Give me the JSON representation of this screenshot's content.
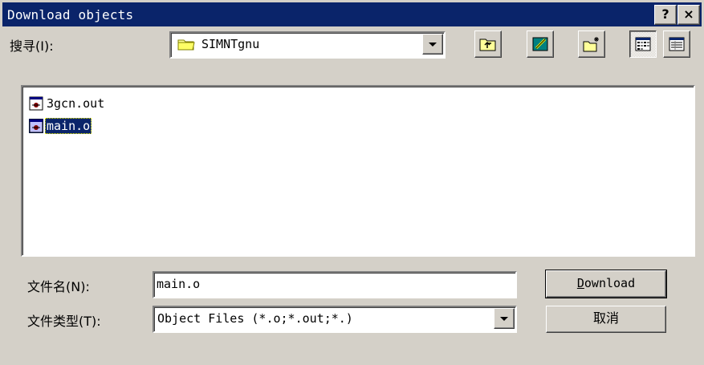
{
  "window": {
    "title": "Download objects",
    "help_label": "?",
    "close_label": "×"
  },
  "lookin": {
    "label": "搜寻(I):",
    "value": "SIMNTgnu"
  },
  "toolbar": {
    "icons": [
      "up-folder-icon",
      "desktop-icon",
      "new-folder-icon",
      "list-view-icon",
      "details-view-icon"
    ]
  },
  "files": [
    {
      "name": "3gcn.out",
      "icon": "executable-file-icon",
      "selected": false
    },
    {
      "name": "main.o",
      "icon": "executable-file-icon",
      "selected": true
    }
  ],
  "filename": {
    "label": "文件名(N):",
    "value": "main.o"
  },
  "filetype": {
    "label": "文件类型(T):",
    "value": "Object Files (*.o;*.out;*.)"
  },
  "buttons": {
    "download_first": "D",
    "download_rest": "ownload",
    "cancel": "取消"
  },
  "colors": {
    "titlebar": "#0a246a",
    "face": "#d4d0c8",
    "selection": "#0a246a"
  }
}
